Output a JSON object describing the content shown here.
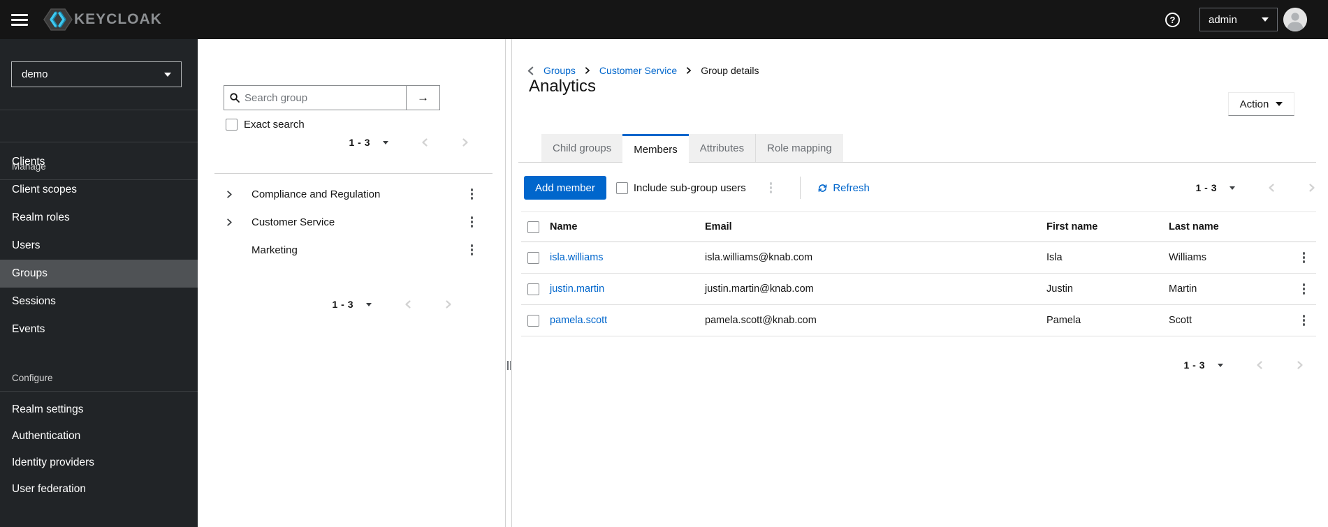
{
  "header": {
    "brand": "KEYCLOAK",
    "help_glyph": "?",
    "user_menu": "admin"
  },
  "sidebar": {
    "realm": "demo",
    "sections": [
      {
        "label": "Manage",
        "items": [
          "Clients",
          "Client scopes",
          "Realm roles",
          "Users",
          "Groups",
          "Sessions",
          "Events"
        ]
      },
      {
        "label": "Configure",
        "items": [
          "Realm settings",
          "Authentication",
          "Identity providers",
          "User federation"
        ]
      }
    ],
    "selected_item": "Groups"
  },
  "tree_panel": {
    "search_placeholder": "Search group",
    "search_go_glyph": "→",
    "exact_search_label": "Exact search",
    "pagination_range": "1 - 3",
    "groups": [
      {
        "name": "Compliance and Regulation",
        "expandable": true
      },
      {
        "name": "Customer Service",
        "expandable": true
      },
      {
        "name": "Marketing",
        "expandable": false
      }
    ]
  },
  "main": {
    "breadcrumb": {
      "items": [
        "Groups",
        "Customer Service"
      ],
      "current": "Group details"
    },
    "title": "Analytics",
    "action_button": "Action",
    "tabs": [
      {
        "label": "Child groups",
        "active": false
      },
      {
        "label": "Members",
        "active": true
      },
      {
        "label": "Attributes",
        "active": false
      },
      {
        "label": "Role mapping",
        "active": false
      }
    ],
    "toolbar": {
      "add_member": "Add member",
      "include_subgroups": "Include sub-group users",
      "refresh": "Refresh",
      "pagination_range": "1 - 3"
    },
    "table": {
      "columns": {
        "name": "Name",
        "email": "Email",
        "first": "First name",
        "last": "Last name"
      },
      "rows": [
        {
          "name": "isla.williams",
          "email": "isla.williams@knab.com",
          "first": "Isla",
          "last": "Williams"
        },
        {
          "name": "justin.martin",
          "email": "justin.martin@knab.com",
          "first": "Justin",
          "last": "Martin"
        },
        {
          "name": "pamela.scott",
          "email": "pamela.scott@knab.com",
          "first": "Pamela",
          "last": "Scott"
        }
      ]
    },
    "bottom_pagination_range": "1 - 3"
  },
  "colors": {
    "primary": "#0066cc",
    "link": "#0066cc",
    "masthead_bg": "#151515",
    "sidebar_bg": "#212427",
    "sidebar_selected_bg": "#4f5255",
    "tab_inactive_bg": "#f0f0f0",
    "border": "#d2d2d2",
    "logo_cyan": "#3fc9f0"
  }
}
